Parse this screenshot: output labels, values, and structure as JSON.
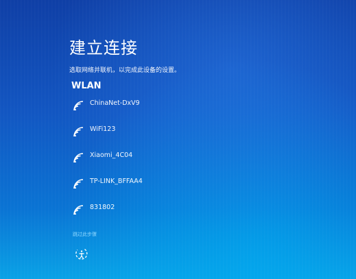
{
  "page": {
    "title": "建立连接",
    "subtitle": "选取网络并联机，以完成此设备的设置。",
    "section_heading": "WLAN"
  },
  "networks": [
    {
      "name": "ChinaNet-DxV9"
    },
    {
      "name": "WiFi123"
    },
    {
      "name": "Xiaomi_4C04"
    },
    {
      "name": "TP-LINK_BFFAA4"
    },
    {
      "name": "831802"
    }
  ],
  "footer": {
    "skip_label": "跳过此步骤"
  },
  "icons": {
    "wifi": "wifi-signal-icon",
    "accessibility": "ease-of-access-icon"
  },
  "colors": {
    "background_top": "#0f3fa6",
    "background_bottom": "#09a2e6",
    "link": "#8fd8ff",
    "text": "#ffffff"
  }
}
